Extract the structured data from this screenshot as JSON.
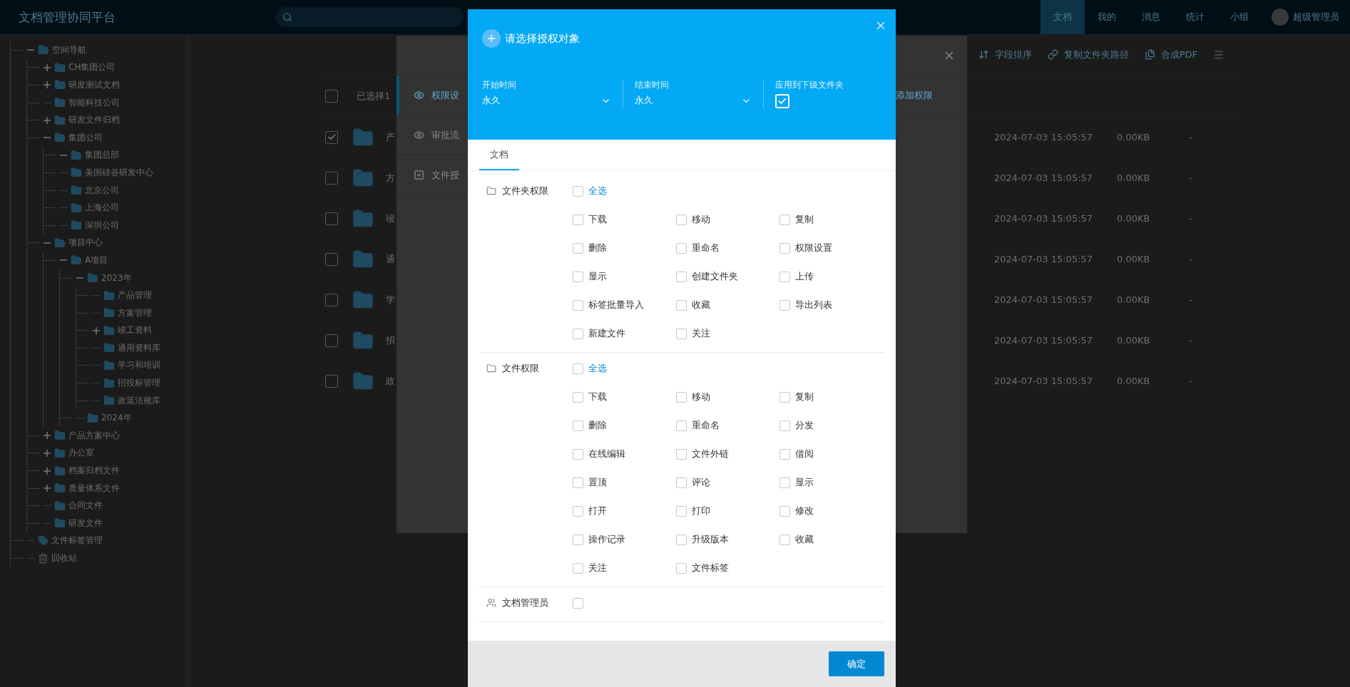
{
  "topbar": {
    "title": "文档管理协同平台",
    "nav": [
      {
        "label": "文档",
        "selected": true
      },
      {
        "label": "我的",
        "selected": false
      },
      {
        "label": "消息",
        "selected": false
      },
      {
        "label": "统计",
        "selected": false
      },
      {
        "label": "小组",
        "selected": false
      }
    ],
    "user": "超级管理员"
  },
  "sidebar": {
    "tree": [
      {
        "label": "空间导航",
        "kind": "folder",
        "expanded": true,
        "children": [
          {
            "label": "CH集团公司",
            "kind": "folder",
            "expanded": false
          },
          {
            "label": "研发测试文档",
            "kind": "folder",
            "expanded": false
          },
          {
            "label": "智能科技公司",
            "kind": "folder"
          },
          {
            "label": "研发文件归档",
            "kind": "folder",
            "expanded": false
          },
          {
            "label": "集团公司",
            "kind": "folder",
            "expanded": true,
            "children": [
              {
                "label": "集团总部",
                "kind": "folder",
                "expanded": true
              },
              {
                "label": "美国硅谷研发中心",
                "kind": "folder"
              },
              {
                "label": "北京公司",
                "kind": "folder"
              },
              {
                "label": "上海公司",
                "kind": "folder"
              },
              {
                "label": "深圳公司",
                "kind": "folder"
              }
            ]
          },
          {
            "label": "项目中心",
            "kind": "folder",
            "expanded": true,
            "children": [
              {
                "label": "A项目",
                "kind": "folder",
                "expanded": true,
                "children": [
                  {
                    "label": "2023年",
                    "kind": "folder",
                    "expanded": true,
                    "children": [
                      {
                        "label": "产品管理",
                        "kind": "folder"
                      },
                      {
                        "label": "方案管理",
                        "kind": "folder"
                      },
                      {
                        "label": "竣工资料",
                        "kind": "folder",
                        "expanded": false
                      },
                      {
                        "label": "通用资料库",
                        "kind": "folder"
                      },
                      {
                        "label": "学习和培训",
                        "kind": "folder"
                      },
                      {
                        "label": "招投标管理",
                        "kind": "folder"
                      },
                      {
                        "label": "政策法规库",
                        "kind": "folder"
                      }
                    ]
                  },
                  {
                    "label": "2024年",
                    "kind": "folder"
                  }
                ]
              }
            ]
          },
          {
            "label": "产品方案中心",
            "kind": "folder",
            "expanded": false
          },
          {
            "label": "办公室",
            "kind": "folder",
            "expanded": false
          },
          {
            "label": "档案归档文件",
            "kind": "folder",
            "expanded": false
          },
          {
            "label": "质量体系文件",
            "kind": "folder",
            "expanded": false
          },
          {
            "label": "合同文件",
            "kind": "folder"
          },
          {
            "label": "研发文件",
            "kind": "folder"
          }
        ]
      },
      {
        "label": "文件标签管理",
        "kind": "tag"
      },
      {
        "label": "回收站",
        "kind": "trash"
      }
    ]
  },
  "toolbar": [
    {
      "label": "字段排序",
      "kind": "sort"
    },
    {
      "label": "复制文件夹路径",
      "kind": "link"
    },
    {
      "label": "合成PDF",
      "kind": "pdf"
    }
  ],
  "file_table": {
    "selection": "已选择1",
    "header_checked": false,
    "rows": [
      {
        "name": "产",
        "checked": true,
        "modified": "2024-07-03 15:05:57",
        "size": "0.00KB",
        "column_3": "-"
      },
      {
        "name": "方",
        "checked": false,
        "modified": "2024-07-03 15:05:57",
        "size": "0.00KB",
        "column_3": "-"
      },
      {
        "name": "竣",
        "checked": false,
        "modified": "2024-07-03 15:05:57",
        "size": "0.00KB",
        "column_3": "-"
      },
      {
        "name": "通",
        "checked": false,
        "modified": "2024-07-03 15:05:57",
        "size": "0.00KB",
        "column_3": "-"
      },
      {
        "name": "学",
        "checked": false,
        "modified": "2024-07-03 15:05:57",
        "size": "0.00KB",
        "column_3": "-"
      },
      {
        "name": "招",
        "checked": false,
        "modified": "2024-07-03 15:05:57",
        "size": "0.00KB",
        "column_3": "-"
      },
      {
        "name": "政",
        "checked": false,
        "modified": "2024-07-03 15:05:57",
        "size": "0.00KB",
        "column_3": "-"
      }
    ]
  },
  "settings_dialog": {
    "menu": [
      {
        "label": "权限设",
        "kind": "eye",
        "selected": true
      },
      {
        "label": "审批流",
        "kind": "eye",
        "selected": false
      },
      {
        "label": "文件授",
        "kind": "check",
        "selected": false
      }
    ],
    "add_link": "添加权限"
  },
  "auth_dialog": {
    "title": "请选择授权对象",
    "fields": [
      {
        "kind": "select",
        "label": "开始时间",
        "value": "永久"
      },
      {
        "kind": "select",
        "label": "结束时间",
        "value": "永久"
      },
      {
        "kind": "checkbox",
        "label": "应用到下级文件夹",
        "checked": true
      }
    ],
    "tabs": [
      {
        "label": "文档",
        "selected": true
      }
    ],
    "sections": [
      {
        "kind": "folder",
        "label": "文件夹权限",
        "select_all": {
          "label": "全选",
          "checked": false
        },
        "items": [
          {
            "label": "下载",
            "checked": false
          },
          {
            "label": "移动",
            "checked": false
          },
          {
            "label": "复制",
            "checked": false
          },
          {
            "label": "删除",
            "checked": false
          },
          {
            "label": "重命名",
            "checked": false
          },
          {
            "label": "权限设置",
            "checked": false
          },
          {
            "label": "显示",
            "checked": false
          },
          {
            "label": "创建文件夹",
            "checked": false
          },
          {
            "label": "上传",
            "checked": false
          },
          {
            "label": "标签批量导入",
            "checked": false
          },
          {
            "label": "收藏",
            "checked": false
          },
          {
            "label": "导出列表",
            "checked": false
          },
          {
            "label": "新建文件",
            "checked": false
          },
          {
            "label": "关注",
            "checked": false
          }
        ]
      },
      {
        "kind": "folder",
        "label": "文件权限",
        "select_all": {
          "label": "全选",
          "checked": false
        },
        "items": [
          {
            "label": "下载",
            "checked": false
          },
          {
            "label": "移动",
            "checked": false
          },
          {
            "label": "复制",
            "checked": false
          },
          {
            "label": "删除",
            "checked": false
          },
          {
            "label": "重命名",
            "checked": false
          },
          {
            "label": "分发",
            "checked": false
          },
          {
            "label": "在线编辑",
            "checked": false
          },
          {
            "label": "文件外链",
            "checked": false
          },
          {
            "label": "借阅",
            "checked": false
          },
          {
            "label": "置顶",
            "checked": false
          },
          {
            "label": "评论",
            "checked": false
          },
          {
            "label": "显示",
            "checked": false
          },
          {
            "label": "打开",
            "checked": false
          },
          {
            "label": "打印",
            "checked": false
          },
          {
            "label": "修改",
            "checked": false
          },
          {
            "label": "操作记录",
            "checked": false
          },
          {
            "label": "升级版本",
            "checked": false
          },
          {
            "label": "收藏",
            "checked": false
          },
          {
            "label": "关注",
            "checked": false
          },
          {
            "label": "文件标签",
            "checked": false
          }
        ]
      },
      {
        "kind": "user",
        "label": "文档管理员",
        "checked": false
      }
    ],
    "confirm": "确定"
  }
}
